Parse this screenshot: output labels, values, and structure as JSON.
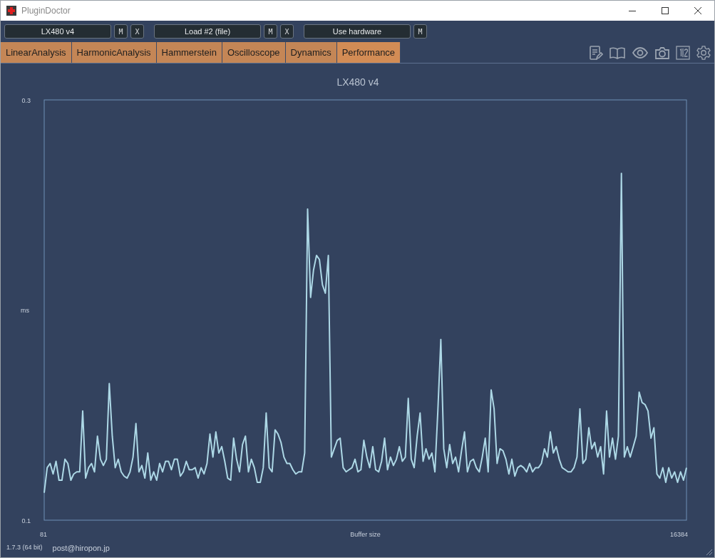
{
  "window": {
    "title": "PluginDoctor"
  },
  "slots": [
    {
      "label": "LX480 v4",
      "buttons": [
        "M",
        "X"
      ]
    },
    {
      "label": "Load #2 (file)",
      "buttons": [
        "M",
        "X"
      ]
    },
    {
      "label": "Use hardware",
      "buttons": [
        "M"
      ]
    }
  ],
  "tabs": [
    {
      "label": "LinearAnalysis",
      "selected": false
    },
    {
      "label": "HarmonicAnalysis",
      "selected": false
    },
    {
      "label": "Hammerstein",
      "selected": false
    },
    {
      "label": "Oscilloscope",
      "selected": false
    },
    {
      "label": "Dynamics",
      "selected": false
    },
    {
      "label": "Performance",
      "selected": true
    }
  ],
  "chart": {
    "x_axis_start": "81",
    "x_axis_end": "16384",
    "chart_data": {
      "type": "line",
      "title": "LX480 v4",
      "xlabel": "Buffer size",
      "ylabel": "ms",
      "ylim": [
        0.1,
        0.3
      ],
      "yticks": [
        0.1,
        0.3
      ],
      "series": [
        {
          "color": "#add8e6",
          "values": [
            0.113,
            0.125,
            0.127,
            0.122,
            0.128,
            0.119,
            0.119,
            0.129,
            0.127,
            0.119,
            0.122,
            0.123,
            0.123,
            0.152,
            0.12,
            0.125,
            0.127,
            0.123,
            0.14,
            0.129,
            0.126,
            0.129,
            0.165,
            0.14,
            0.125,
            0.129,
            0.123,
            0.121,
            0.12,
            0.123,
            0.13,
            0.146,
            0.123,
            0.126,
            0.12,
            0.132,
            0.119,
            0.123,
            0.119,
            0.127,
            0.123,
            0.128,
            0.128,
            0.124,
            0.129,
            0.129,
            0.121,
            0.123,
            0.128,
            0.124,
            0.124,
            0.125,
            0.12,
            0.125,
            0.122,
            0.127,
            0.141,
            0.13,
            0.142,
            0.132,
            0.135,
            0.128,
            0.12,
            0.119,
            0.139,
            0.129,
            0.123,
            0.136,
            0.14,
            0.123,
            0.129,
            0.125,
            0.118,
            0.118,
            0.125,
            0.151,
            0.125,
            0.123,
            0.143,
            0.141,
            0.137,
            0.13,
            0.127,
            0.127,
            0.124,
            0.122,
            0.123,
            0.123,
            0.132,
            0.248,
            0.206,
            0.219,
            0.226,
            0.224,
            0.212,
            0.208,
            0.226,
            0.13,
            0.134,
            0.138,
            0.139,
            0.125,
            0.123,
            0.124,
            0.125,
            0.129,
            0.123,
            0.124,
            0.138,
            0.13,
            0.125,
            0.135,
            0.124,
            0.123,
            0.128,
            0.139,
            0.124,
            0.13,
            0.126,
            0.129,
            0.135,
            0.128,
            0.13,
            0.158,
            0.129,
            0.125,
            0.14,
            0.151,
            0.128,
            0.134,
            0.129,
            0.132,
            0.123,
            0.152,
            0.186,
            0.134,
            0.125,
            0.136,
            0.127,
            0.13,
            0.123,
            0.133,
            0.142,
            0.123,
            0.128,
            0.129,
            0.125,
            0.123,
            0.13,
            0.139,
            0.123,
            0.162,
            0.153,
            0.127,
            0.134,
            0.133,
            0.129,
            0.122,
            0.129,
            0.121,
            0.125,
            0.126,
            0.125,
            0.123,
            0.127,
            0.123,
            0.125,
            0.125,
            0.127,
            0.134,
            0.13,
            0.142,
            0.132,
            0.135,
            0.129,
            0.125,
            0.124,
            0.123,
            0.123,
            0.125,
            0.13,
            0.153,
            0.127,
            0.129,
            0.144,
            0.134,
            0.137,
            0.13,
            0.135,
            0.122,
            0.152,
            0.13,
            0.139,
            0.129,
            0.14,
            0.265,
            0.13,
            0.135,
            0.13,
            0.135,
            0.14,
            0.161,
            0.156,
            0.155,
            0.152,
            0.139,
            0.144,
            0.122,
            0.12,
            0.125,
            0.118,
            0.125,
            0.12,
            0.123,
            0.118,
            0.123,
            0.119,
            0.125
          ]
        }
      ]
    }
  },
  "status_bar": {
    "version": "1.7.3 (64 bit)",
    "contact": "post@hiropon.jp"
  }
}
